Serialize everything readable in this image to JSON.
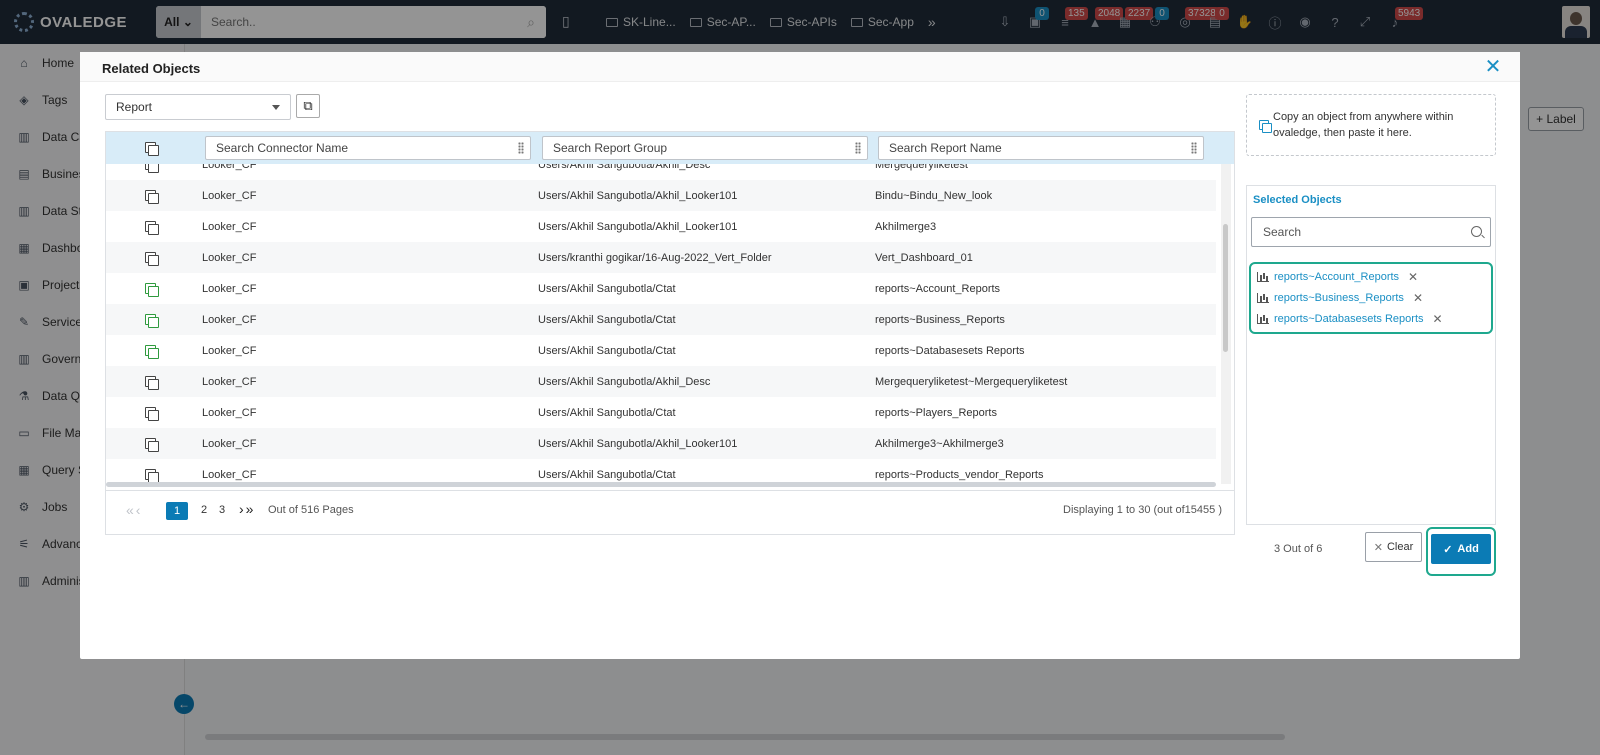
{
  "app": {
    "logo_text": "OVALEDGE"
  },
  "topbar": {
    "search_scope": "All",
    "search_placeholder": "Search..",
    "folders": [
      "SK-Line...",
      "Sec-AP...",
      "Sec-APIs",
      "Sec-App"
    ],
    "badges": [
      {
        "icon": "download-icon",
        "count": ""
      },
      {
        "icon": "inbox-icon",
        "count": "0",
        "color": "#1a8fc4"
      },
      {
        "icon": "database-icon",
        "count": "135",
        "color": "#d24b4b"
      },
      {
        "icon": "alert-icon",
        "count": "2048",
        "color": "#d24b4b"
      },
      {
        "icon": "calendar-icon",
        "count": "2237",
        "color": "#d24b4b"
      },
      {
        "icon": "user-add-icon",
        "count": "0",
        "color": "#1a8fc4"
      },
      {
        "icon": "ai-icon",
        "count": "37328",
        "color": "#d24b4b"
      },
      {
        "icon": "clipboard-icon",
        "count": "0",
        "color": "#d24b4b"
      },
      {
        "icon": "hand-icon",
        "count": ""
      },
      {
        "icon": "info-icon",
        "count": ""
      },
      {
        "icon": "chrome-icon",
        "count": ""
      },
      {
        "icon": "help-icon",
        "count": ""
      },
      {
        "icon": "fullscreen-icon",
        "count": ""
      },
      {
        "icon": "bell-icon",
        "count": "5943",
        "color": "#d24b4b"
      }
    ]
  },
  "sidebar": {
    "items": [
      {
        "label": "Home",
        "icon": "home-icon"
      },
      {
        "label": "Tags",
        "icon": "tag-icon"
      },
      {
        "label": "Data Cata",
        "icon": "catalog-icon"
      },
      {
        "label": "Business",
        "icon": "glossary-icon"
      },
      {
        "label": "Data Stor",
        "icon": "story-icon"
      },
      {
        "label": "Dashboa",
        "icon": "dashboard-icon"
      },
      {
        "label": "Projects",
        "icon": "projects-icon"
      },
      {
        "label": "Service D",
        "icon": "service-icon"
      },
      {
        "label": "Governan",
        "icon": "governance-icon"
      },
      {
        "label": "Data Qua",
        "icon": "quality-icon"
      },
      {
        "label": "File Mana",
        "icon": "folder-icon"
      },
      {
        "label": "Query Sh",
        "icon": "query-icon"
      },
      {
        "label": "Jobs",
        "icon": "jobs-icon"
      },
      {
        "label": "Advance",
        "icon": "advanced-icon"
      },
      {
        "label": "Administ",
        "icon": "admin-icon"
      }
    ]
  },
  "background": {
    "label_button": "+ Label"
  },
  "modal": {
    "title": "Related Objects",
    "object_type": "Report",
    "columns": {
      "connector_placeholder": "Search Connector Name",
      "group_placeholder": "Search Report Group",
      "name_placeholder": "Search Report Name"
    },
    "rows": [
      {
        "connector": "Looker_CF",
        "group": "Users/Akhil Sangubotla/Akhil_Desc",
        "name": "Mergequeryliketest",
        "selected": false
      },
      {
        "connector": "Looker_CF",
        "group": "Users/Akhil Sangubotla/Akhil_Looker101",
        "name": "Bindu~Bindu_New_look",
        "selected": false
      },
      {
        "connector": "Looker_CF",
        "group": "Users/Akhil Sangubotla/Akhil_Looker101",
        "name": "Akhilmerge3",
        "selected": false
      },
      {
        "connector": "Looker_CF",
        "group": "Users/kranthi gogikar/16-Aug-2022_Vert_Folder",
        "name": "Vert_Dashboard_01",
        "selected": false
      },
      {
        "connector": "Looker_CF",
        "group": "Users/Akhil Sangubotla/Ctat",
        "name": "reports~Account_Reports",
        "selected": true
      },
      {
        "connector": "Looker_CF",
        "group": "Users/Akhil Sangubotla/Ctat",
        "name": "reports~Business_Reports",
        "selected": true
      },
      {
        "connector": "Looker_CF",
        "group": "Users/Akhil Sangubotla/Ctat",
        "name": "reports~Databasesets Reports",
        "selected": true
      },
      {
        "connector": "Looker_CF",
        "group": "Users/Akhil Sangubotla/Akhil_Desc",
        "name": "Mergequeryliketest~Mergequeryliketest",
        "selected": false
      },
      {
        "connector": "Looker_CF",
        "group": "Users/Akhil Sangubotla/Ctat",
        "name": "reports~Players_Reports",
        "selected": false
      },
      {
        "connector": "Looker_CF",
        "group": "Users/Akhil Sangubotla/Akhil_Looker101",
        "name": "Akhilmerge3~Akhilmerge3",
        "selected": false
      },
      {
        "connector": "Looker_CF",
        "group": "Users/Akhil Sangubotla/Ctat",
        "name": "reports~Products_vendor_Reports",
        "selected": false
      }
    ],
    "pager": {
      "current": "1",
      "page2": "2",
      "page3": "3",
      "total": "Out of 516 Pages",
      "display": "Displaying 1 to 30   (out of15455 )"
    },
    "paste_hint": "Copy an object from anywhere within ovaledge, then paste it here.",
    "selected": {
      "title": "Selected Objects",
      "search_placeholder": "Search",
      "items": [
        "reports~Account_Reports",
        "reports~Business_Reports",
        "reports~Databasesets Reports"
      ]
    },
    "count": "3 Out of 6",
    "clear_label": "Clear",
    "add_label": "Add"
  }
}
